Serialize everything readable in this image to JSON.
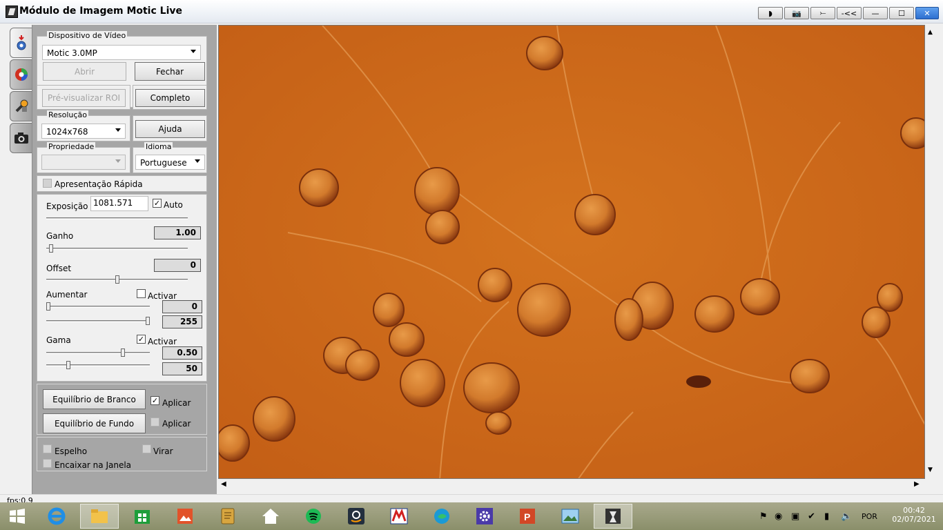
{
  "window": {
    "title": "Módulo de Imagem Motic Live"
  },
  "title_buttons": [
    "◗",
    "📷",
    "⤚",
    "-<<",
    "—",
    "☐",
    "✕"
  ],
  "toolstrip": {
    "tabs": [
      "settings-tab",
      "color-tab",
      "tools-tab",
      "camera-tab"
    ]
  },
  "video_device": {
    "group_label": "Dispositivo de Vídeo",
    "device": "Motic 3.0MP",
    "open_label": "Abrir",
    "close_label": "Fechar"
  },
  "preview": {
    "roi_label": "Pré-visualizar ROI",
    "full_label": "Completo"
  },
  "resolution": {
    "group_label": "Resolução",
    "value": "1024x768",
    "help_label": "Ajuda"
  },
  "property": {
    "group_label": "Propriedade",
    "value": ""
  },
  "language": {
    "group_label": "Idioma",
    "value": "Portuguese"
  },
  "quick_presentation": {
    "label": "Apresentação Rápida",
    "checked": false
  },
  "exposure": {
    "label": "Exposição",
    "value": "1081.571",
    "auto_label": "Auto",
    "auto_checked": true
  },
  "gain": {
    "label": "Ganho",
    "value": "1.00",
    "slider_level": 0.02
  },
  "offset": {
    "label": "Offset",
    "value": "0",
    "slider_level": 0.5
  },
  "enhance": {
    "label": "Aumentar",
    "activate_label": "Activar",
    "checked": false,
    "min_value": "0",
    "max_value": "255",
    "min_level": 0.0,
    "max_level": 1.0
  },
  "gamma": {
    "label": "Gama",
    "activate_label": "Activar",
    "checked": true,
    "value1": "0.50",
    "value2": "50",
    "level1": 0.75,
    "level2": 0.2
  },
  "white_balance": {
    "button_label": "Equilíbrio de Branco",
    "apply_label": "Aplicar",
    "apply_checked": true
  },
  "background_balance": {
    "button_label": "Equilíbrio de Fundo",
    "apply_label": "Aplicar",
    "apply_checked": false
  },
  "options": {
    "mirror_label": "Espelho",
    "flip_label": "Virar",
    "fit_label": "Encaixar na Janela"
  },
  "status": {
    "fps": "fps:0.9"
  },
  "taskbar": {
    "apps": [
      "windows",
      "internet-explorer",
      "file-explorer",
      "office",
      "photos",
      "notes",
      "home",
      "spotify",
      "amazon",
      "motic",
      "edge",
      "settings",
      "powerpoint",
      "image-viewer",
      "motic-live"
    ],
    "language": "POR",
    "time": "00:42",
    "date": "02/07/2021"
  }
}
